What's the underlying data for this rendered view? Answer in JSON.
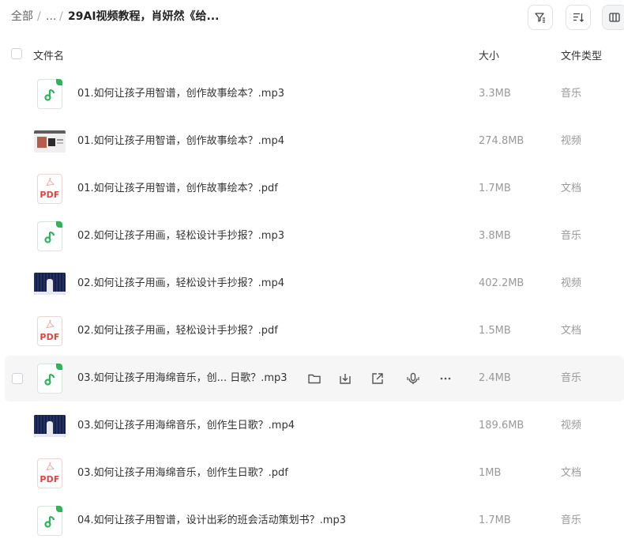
{
  "breadcrumb": {
    "root": "全部",
    "sep1": "/",
    "ellipsis": "...",
    "sep2": "/",
    "current": "29AI视频教程，肖妍然《给..."
  },
  "header": {
    "name": "文件名",
    "size": "大小",
    "type": "文件类型"
  },
  "files": [
    {
      "name": "01.如何让孩子用智谱，创作故事绘本？.mp3",
      "size": "3.3MB",
      "type": "音乐",
      "icon": "audio-file-icon"
    },
    {
      "name": "01.如何让孩子用智谱，创作故事绘本？.mp4",
      "size": "274.8MB",
      "type": "视频",
      "icon": "video-thumbnail-icon"
    },
    {
      "name": "01.如何让孩子用智谱，创作故事绘本？.pdf",
      "size": "1.7MB",
      "type": "文档",
      "icon": "pdf-file-icon"
    },
    {
      "name": "02.如何让孩子用画，轻松设计手抄报？.mp3",
      "size": "3.8MB",
      "type": "音乐",
      "icon": "audio-file-icon"
    },
    {
      "name": "02.如何让孩子用画，轻松设计手抄报？.mp4",
      "size": "402.2MB",
      "type": "视频",
      "icon": "video-thumbnail-icon"
    },
    {
      "name": "02.如何让孩子用画，轻松设计手抄报？.pdf",
      "size": "1.5MB",
      "type": "文档",
      "icon": "pdf-file-icon"
    },
    {
      "name": "03.如何让孩子用海绵音乐，创... 日歌？.mp3",
      "size": "2.4MB",
      "type": "音乐",
      "icon": "audio-file-icon"
    },
    {
      "name": "03.如何让孩子用海绵音乐，创作生日歌？.mp4",
      "size": "189.6MB",
      "type": "视频",
      "icon": "video-thumbnail-icon"
    },
    {
      "name": "03.如何让孩子用海绵音乐，创作生日歌？.pdf",
      "size": "1MB",
      "type": "文档",
      "icon": "pdf-file-icon"
    },
    {
      "name": "04.如何让孩子用智谱，设计出彩的班会活动策划书？.mp3",
      "size": "1.7MB",
      "type": "音乐",
      "icon": "audio-file-icon"
    }
  ],
  "pdf_label": "PDF",
  "colors": {
    "audio_accent": "#2fb45a",
    "pdf_accent": "#e8413e",
    "hover_row": "#f6f6f7"
  }
}
